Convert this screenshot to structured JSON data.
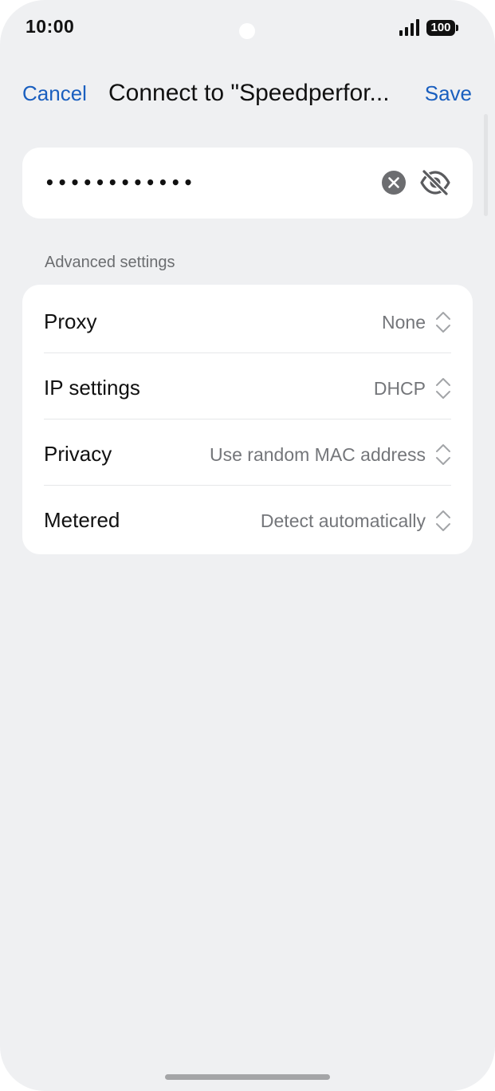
{
  "status_bar": {
    "time": "10:00",
    "battery": "100",
    "icons": [
      "signal-icon",
      "battery-icon"
    ]
  },
  "header": {
    "cancel_label": "Cancel",
    "title": "Connect to \"Speedperfor...",
    "save_label": "Save"
  },
  "password": {
    "value": "••••••••••••",
    "clear_icon": "clear-icon",
    "visibility_icon": "eye-off-icon"
  },
  "advanced": {
    "section_label": "Advanced settings",
    "rows": [
      {
        "label": "Proxy",
        "value": "None"
      },
      {
        "label": "IP settings",
        "value": "DHCP"
      },
      {
        "label": "Privacy",
        "value": "Use random MAC address"
      },
      {
        "label": "Metered",
        "value": "Detect automatically"
      }
    ]
  },
  "colors": {
    "accent": "#1a5fbf",
    "background": "#eff0f2",
    "card": "#ffffff",
    "secondary_text": "#74767a"
  }
}
